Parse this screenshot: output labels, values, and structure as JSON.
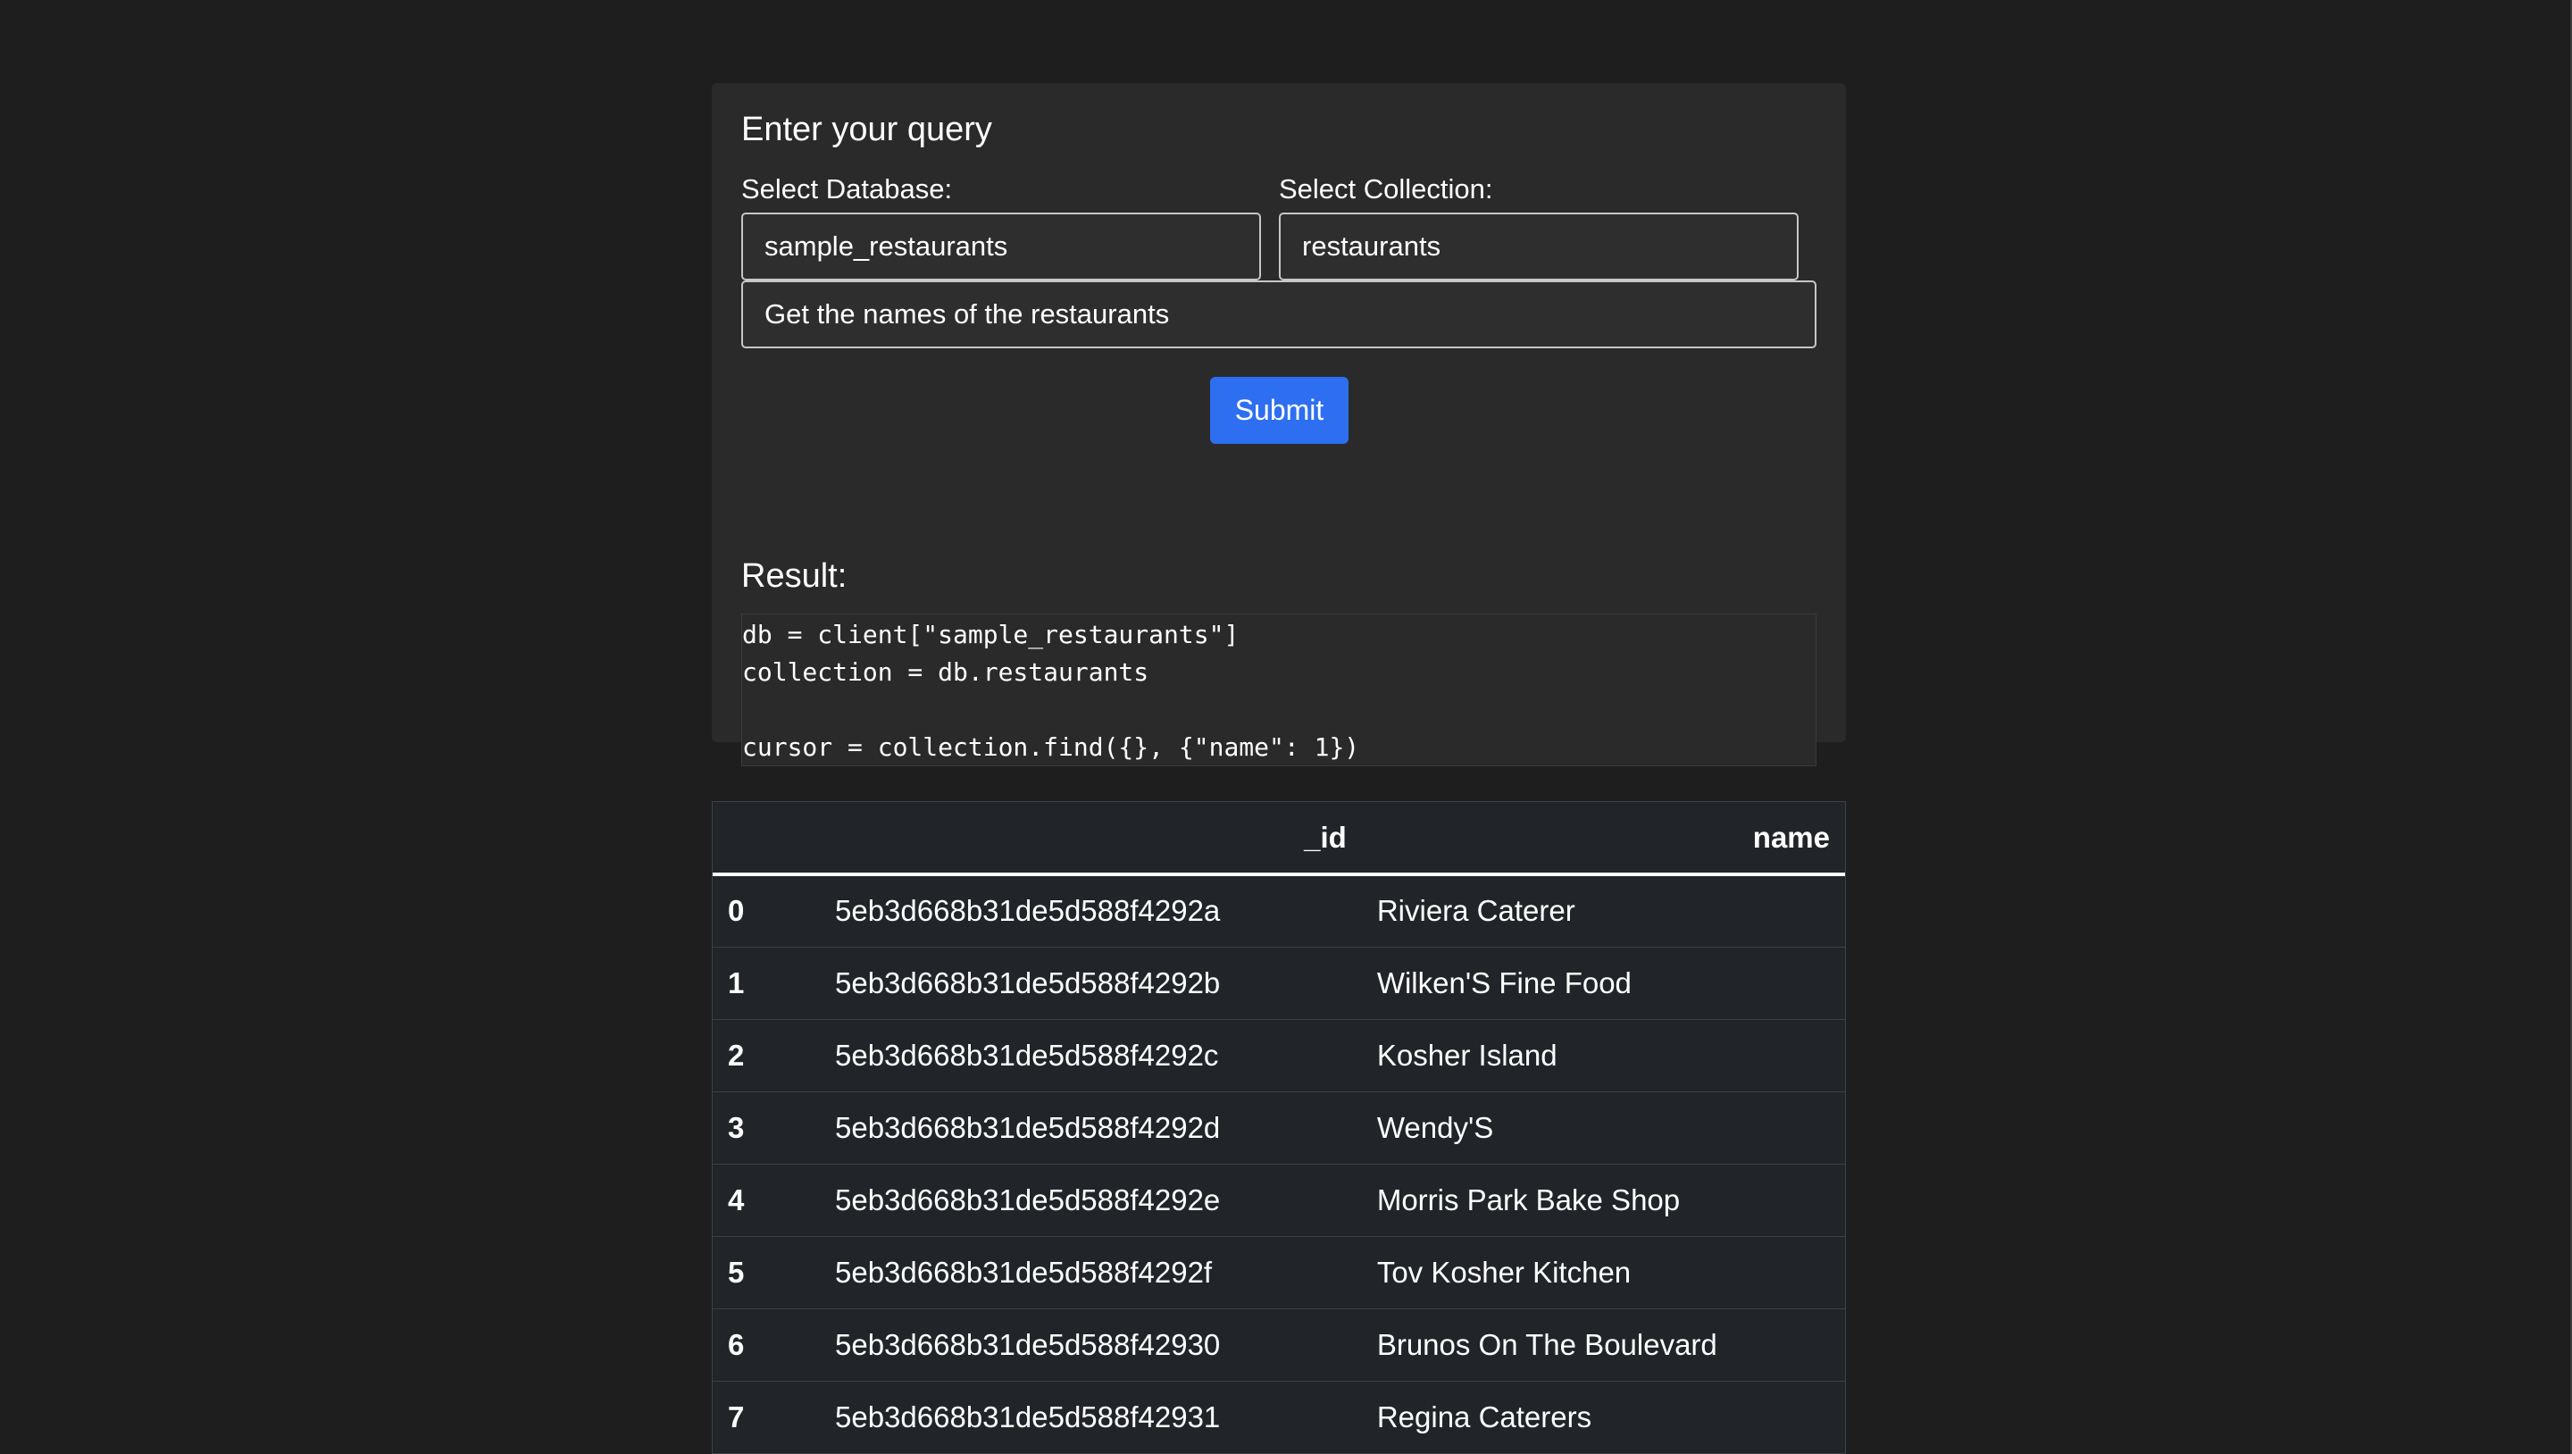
{
  "form": {
    "title": "Enter your query",
    "database_label": "Select Database:",
    "database_value": "sample_restaurants",
    "collection_label": "Select Collection:",
    "collection_value": "restaurants",
    "query_value": "Get the names of the restaurants",
    "submit_label": "Submit"
  },
  "result": {
    "title": "Result:",
    "code": "db = client[\"sample_restaurants\"]\ncollection = db.restaurants\n\ncursor = collection.find({}, {\"name\": 1})"
  },
  "table": {
    "columns": [
      "",
      "_id",
      "name"
    ],
    "rows": [
      {
        "index": "0",
        "id": "5eb3d668b31de5d588f4292a",
        "name": "Riviera Caterer"
      },
      {
        "index": "1",
        "id": "5eb3d668b31de5d588f4292b",
        "name": "Wilken'S Fine Food"
      },
      {
        "index": "2",
        "id": "5eb3d668b31de5d588f4292c",
        "name": "Kosher Island"
      },
      {
        "index": "3",
        "id": "5eb3d668b31de5d588f4292d",
        "name": "Wendy'S"
      },
      {
        "index": "4",
        "id": "5eb3d668b31de5d588f4292e",
        "name": "Morris Park Bake Shop"
      },
      {
        "index": "5",
        "id": "5eb3d668b31de5d588f4292f",
        "name": "Tov Kosher Kitchen"
      },
      {
        "index": "6",
        "id": "5eb3d668b31de5d588f42930",
        "name": "Brunos On The Boulevard"
      },
      {
        "index": "7",
        "id": "5eb3d668b31de5d588f42931",
        "name": "Regina Caterers"
      }
    ]
  },
  "colors": {
    "page_background": "#1e1e1f",
    "panel_background": "#2a2a2b",
    "accent": "#2d6ff0",
    "table_background": "#212529"
  }
}
